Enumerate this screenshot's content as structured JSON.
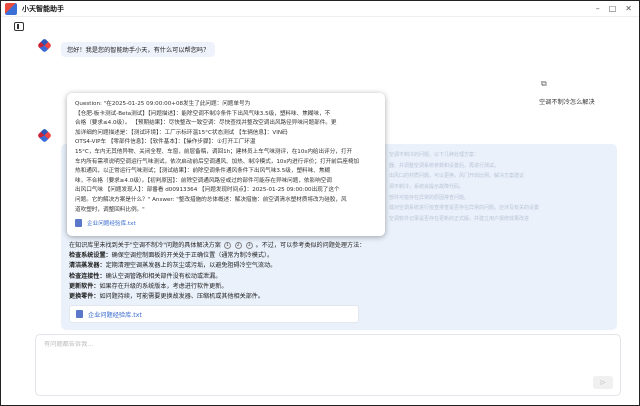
{
  "window": {
    "title": "小天智能助手",
    "minimize": "–",
    "maximize": "□",
    "close": "✕"
  },
  "chat": {
    "greeting": "您好！我是您的智能助手小天，有什么可以帮您吗？",
    "user_message": "空调不制冷怎么解决",
    "copy_icon": "⧉"
  },
  "tooltip": {
    "lines": [
      "Question: \"在2025-01-25 09:00:00+08发生了此问题：问题单号为",
      "【仓肥-板卡测试-Beta测试】【问题描述】：能除空调不制冷条件下出风气味3.5级，塑料味、焦糊味，不",
      "合格（要求≤4.0级）。 【预期结果】：尽快整改一致空调：尽快查找并整改空调出风路径异味问题部件。更",
      "加详细的问题描述是：【测试环境】：工厂示标环温15°C状态测试 【车辆信息】：VIN码",
      "OTS4-VIP车 【零部件信息】：【软件基本】：【操作步骤】：①打开工厂环温",
      "15°C，车内无其他异物、关闭全程、车窗，前层备稿，调回1h；建林员上车气味测评，在10s内给出评分，打开",
      "车内所有需项说明空调运行气味测试，依次启动前后空调通风、加热、制冷模式，10s内进行评价；打开前后座椅加",
      "热和通风，以正常运行气味测试；【测试结果】：前除空调条件通风条件下出风气味3.5级，塑料味、焦糊",
      "味，不合格（要求≥4.0级）。【初判原因】：前除空调通风路径或过的部件可能存在异味问题，依影响空调",
      "出风口气味 【问题发现人】：部番看 d00913364 【问题发现时间点】：2025-01-25 09:00:00出现了这个",
      "问题。它的解决方案是什么？\" Answer: \"整改措施的总体概述：解决措施：前空调清水塑材质将改为硅胶，风",
      "道吹塑时，调整回料比例。\""
    ],
    "file_label": "企业问题经验库.txt"
  },
  "answer": {
    "intro": "在知识库里未找到关于\"空调不制冷\"问题的具体解决方案",
    "intro_tail": "。不过，可以参考类似的问题处理方法：",
    "cite1": "1",
    "cite2": "2",
    "cite3": "3",
    "items": [
      {
        "label": "检查系统设置：",
        "text": "确保空调控制面板的开关处于正确位置（通常为制冷模式）。"
      },
      {
        "label": "清洁蒸发器：",
        "text": "定期清理空调蒸发器上的灰尘或污垢，以避免阻碍冷空气流动。"
      },
      {
        "label": "检查连接性：",
        "text": "确认空调管路和相关部件没有松动或泄漏。"
      },
      {
        "label": "更新软件：",
        "text": "如果存在升级的系统版本，考虑进行软件更新。"
      },
      {
        "label": "更换零件：",
        "text": "如问题持续，可能需要更换故发器、压缩机或其他相关部件。"
      }
    ],
    "file_label": "企业问题经验库.txt",
    "faded_lines": [
      "空调不制冷的问题，以下几种处理方案：",
      "器、并调整空调系统参数和设置后，再进行测试。",
      "出风口的材质问题，可以更换，风门开启比例，解决方案建议",
      "调不制冷，系统会提示故障代码。",
      "部件可能存在异常的原因排查问题。",
      "或对空调系统进行检查排查是否存在异常的问题，还涉及有关的设置",
      "空调软件记录是否存在更新的正式版，并建立用户报修效果改进"
    ]
  },
  "input": {
    "placeholder": "有问题都告诉我...",
    "send_icon": "▷"
  }
}
